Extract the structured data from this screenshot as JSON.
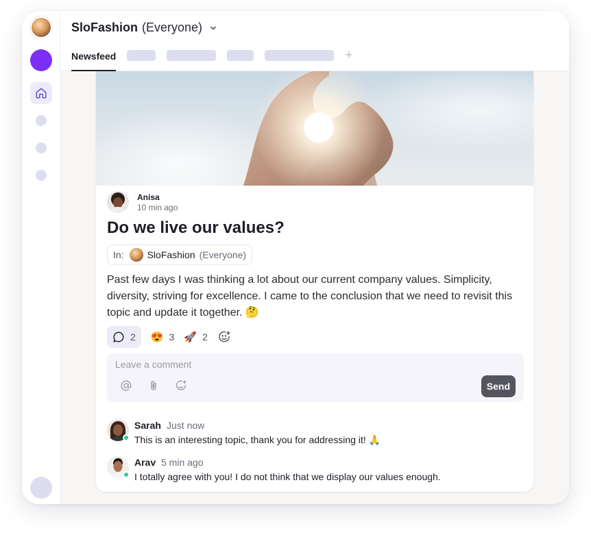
{
  "workspace": {
    "name": "SloFashion",
    "scope": "(Everyone)"
  },
  "tabs": {
    "active": "Newsfeed",
    "add": "+"
  },
  "post": {
    "author": "Anisa",
    "time": "10 min ago",
    "title": "Do we live our values?",
    "in_label": "In:",
    "channel_name": "SloFashion",
    "channel_scope": "(Everyone)",
    "body": "Past few days I was thinking a lot about our current company values. Simplicity, diversity, striving for excellence. I came to the conclusion that we need to revisit this topic and update it together. 🤔",
    "reactions": {
      "comments": "2",
      "heart_eyes_emoji": "😍",
      "heart_eyes_count": "3",
      "rocket_emoji": "🚀",
      "rocket_count": "2"
    }
  },
  "comment_box": {
    "placeholder": "Leave a comment",
    "send_label": "Send"
  },
  "comments": [
    {
      "name": "Sarah",
      "time": "Just now",
      "text": "This is an interesting topic, thank you for addressing it! 🙏"
    },
    {
      "name": "Arav",
      "time": "5 min ago",
      "text": "I totally agree with you! I do not think that we display our values enough."
    }
  ],
  "colors": {
    "accent": "#7b2ff7",
    "online": "#2ecc9a",
    "send_button": "#55555f",
    "placeholder_gray": "#dcdef0"
  },
  "icons": [
    "home-icon",
    "chevron-down-icon",
    "plus-icon",
    "comment-bubble-icon",
    "add-reaction-icon",
    "at-icon",
    "paperclip-icon",
    "emoji-icon"
  ]
}
